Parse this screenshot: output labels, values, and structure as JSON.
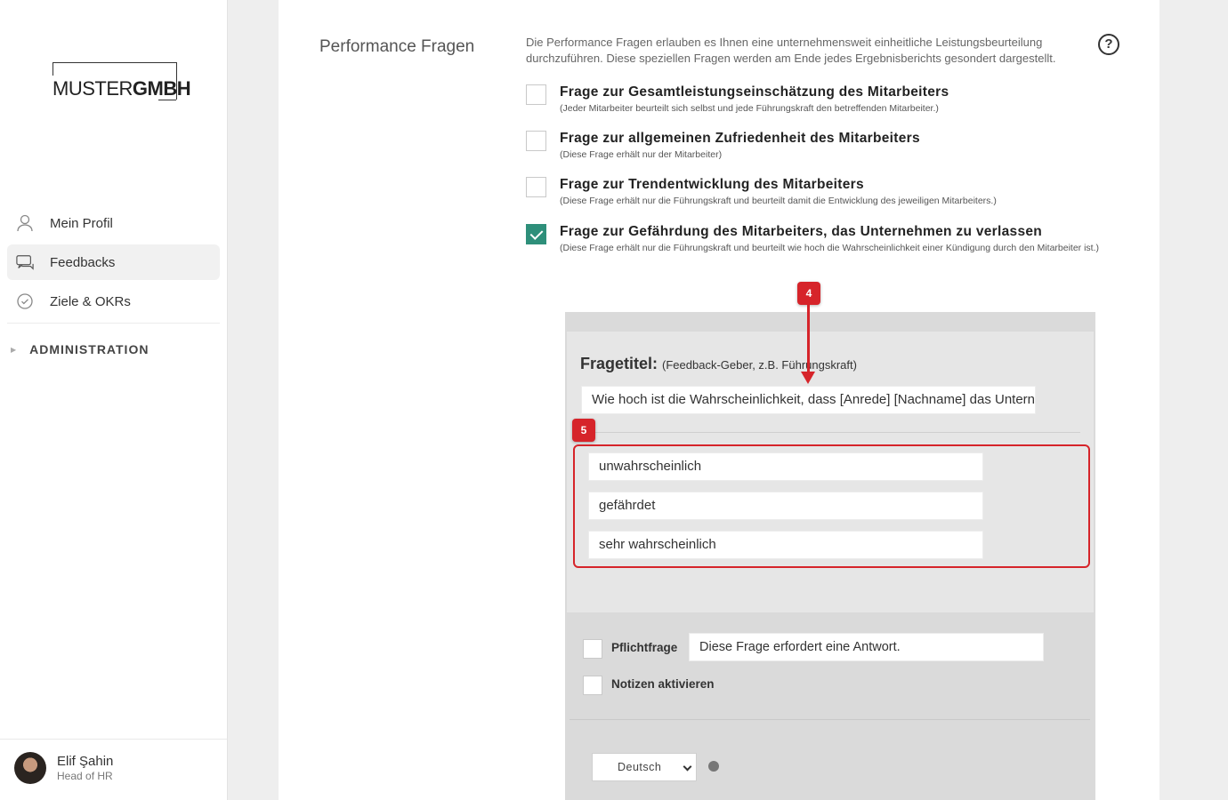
{
  "sidebar": {
    "logo": {
      "part1": "MUSTER",
      "part2": "GMBH"
    },
    "nav": [
      {
        "label": "Mein Profil",
        "icon": "user-icon",
        "active": false
      },
      {
        "label": "Feedbacks",
        "icon": "chat-icon",
        "active": true
      },
      {
        "label": "Ziele & OKRs",
        "icon": "check-circle-icon",
        "active": false
      }
    ],
    "admin_label": "ADMINISTRATION",
    "user": {
      "name": "Elif Şahin",
      "role": "Head of HR"
    }
  },
  "main": {
    "section_title": "Performance Fragen",
    "section_desc": "Die Performance Fragen erlauben es Ihnen eine unternehmensweit einheitliche Leistungsbeurteilung durchzuführen. Diese speziellen Fragen werden am Ende jedes Ergebnisberichts gesondert dargestellt.",
    "help_symbol": "?",
    "options": [
      {
        "title": "Frage zur Gesamtleistungseinschätzung des Mitarbeiters",
        "subtitle": "(Jeder Mitarbeiter beurteilt sich selbst und jede Führungskraft den betreffenden Mitarbeiter.)",
        "checked": false
      },
      {
        "title": "Frage zur allgemeinen Zufriedenheit des Mitarbeiters",
        "subtitle": "(Diese Frage erhält nur der Mitarbeiter)",
        "checked": false
      },
      {
        "title": "Frage zur Trendentwicklung des Mitarbeiters",
        "subtitle": "(Diese Frage erhält nur die Führungskraft und beurteilt damit die Entwicklung des jeweiligen Mitarbeiters.)",
        "checked": false
      },
      {
        "title": "Frage zur Gefährdung des Mitarbeiters, das Unternehmen zu verlassen",
        "subtitle": "(Diese Frage erhält nur die Führungskraft und beurteilt wie hoch die Wahrscheinlichkeit einer Kündigung durch den Mitarbeiter ist.)",
        "checked": true
      }
    ],
    "editor": {
      "fragetitel_label": "Fragetitel:",
      "fragetitel_hint": "(Feedback-Geber, z.B. Führungskraft)",
      "question_value": "Wie hoch ist die Wahrscheinlichkeit, dass [Anrede] [Nachname] das Unternehmen verlässt?",
      "answers": [
        "unwahrscheinlich",
        "gefährdet",
        "sehr wahrscheinlich"
      ],
      "pflichtfrage_label": "Pflichtfrage",
      "pflichtfrage_text": "Diese Frage erfordert eine Antwort.",
      "notizen_label": "Notizen aktivieren",
      "language": "Deutsch"
    },
    "annotations": {
      "badge4": "4",
      "badge5": "5",
      "color": "#d6242a"
    }
  },
  "colors": {
    "accent": "#2e8f7a",
    "annotation": "#d6242a"
  }
}
